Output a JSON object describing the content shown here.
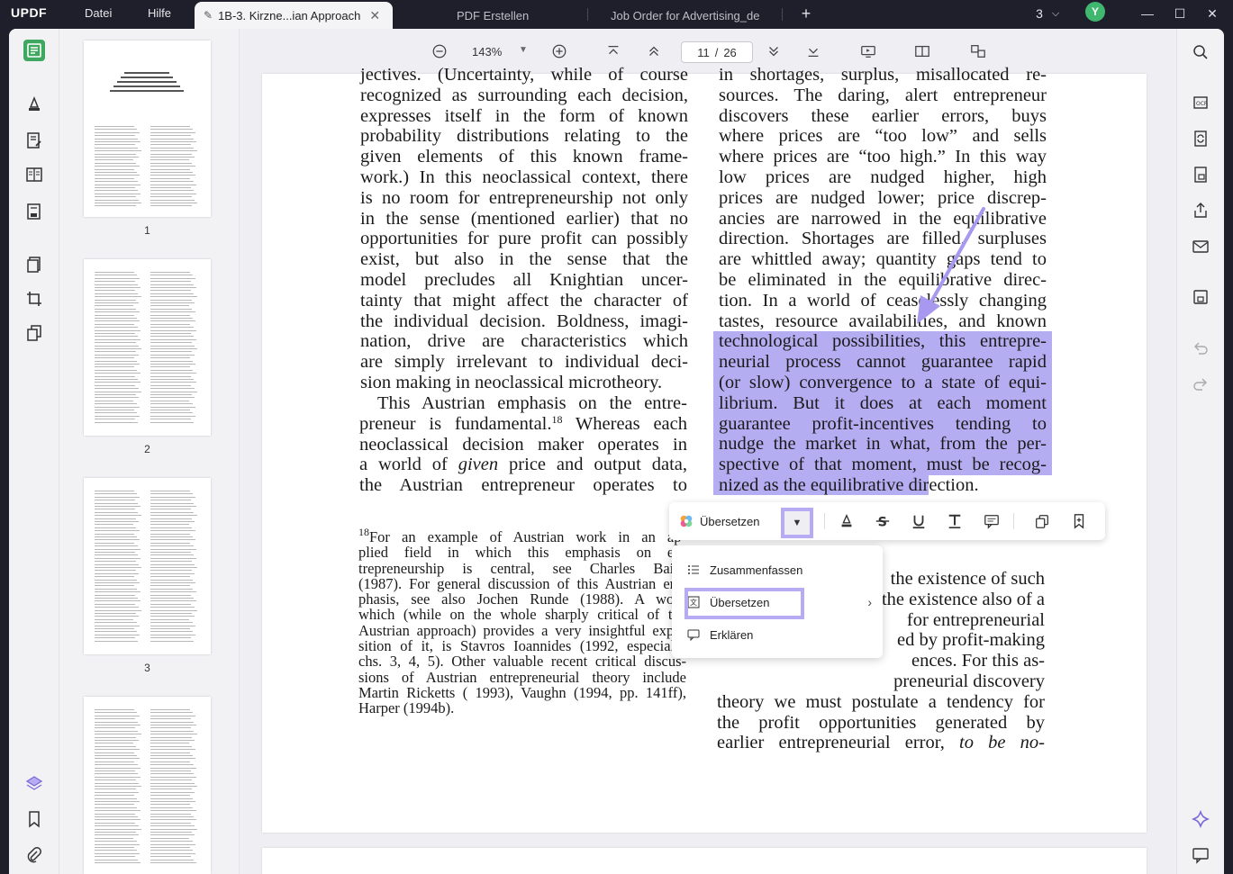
{
  "app": {
    "name_prefix": "UPDF",
    "menu": [
      "Datei",
      "Hilfe"
    ]
  },
  "tabs": [
    {
      "label": "1B-3. Kirzne...ian Approach",
      "active": true
    },
    {
      "label": "PDF Erstellen",
      "active": false
    },
    {
      "label": "Job Order for Advertising_de",
      "active": false
    }
  ],
  "window": {
    "tab_count": "3",
    "avatar_initial": "Y"
  },
  "toolbar": {
    "zoom": "143%",
    "page_current": "11",
    "page_total": "26",
    "page_sep": "/"
  },
  "thumbnails": [
    {
      "num": "1"
    },
    {
      "num": "2"
    },
    {
      "num": "3"
    }
  ],
  "left_column": [
    {
      "t": "jectives. (Uncertainty, while of course"
    },
    {
      "t": "recognized as surrounding each decision,"
    },
    {
      "t": "expresses itself in the form of known"
    },
    {
      "t": "probability distributions relating to the"
    },
    {
      "t": "given elements of this known frame-"
    },
    {
      "t": "work.) In this neoclassical context, there"
    },
    {
      "t": "is no room for entrepreneurship not only"
    },
    {
      "t": "in the sense (mentioned earlier) that no"
    },
    {
      "t": "opportunities for pure profit can possibly"
    },
    {
      "t": "exist, but also in the sense that the"
    },
    {
      "t": "model precludes all Knightian uncer-"
    },
    {
      "t": "tainty that might affect the character of"
    },
    {
      "t": "the individual decision. Boldness, imagi-"
    },
    {
      "t": "nation, drive are characteristics which"
    },
    {
      "t": "are simply irrelevant to individual deci-"
    },
    {
      "t": "sion making in neoclassical microtheory."
    }
  ],
  "left_para2": {
    "l1": "This Austrian emphasis on the entre-",
    "l2a": "preneur is fundamental.",
    "l2sup": "18",
    "l2b": " Whereas each",
    "l3": "neoclassical decision maker operates in",
    "l4a": "a world of ",
    "l4em": "given",
    "l4b": " price and output data,",
    "l5": "the Austrian entrepreneur operates to"
  },
  "footnote": {
    "sup": "18",
    "l1": "For an example of Austrian work in an ap-",
    "lines": [
      "plied field in which this emphasis on en-",
      "trepreneurship is central, see Charles Baird",
      "(1987). For general discussion of this Austrian em-",
      "phasis, see also Jochen Runde (1988). A work",
      "which (while on the whole sharply critical of the",
      "Austrian approach) provides a very insightful expo-",
      "sition of it, is Stavros Ioannides (1992, especially",
      "chs. 3, 4, 5). Other valuable recent critical discus-",
      "sions of Austrian entrepreneurial theory include",
      "Martin Ricketts ( 1993), Vaughn (1994, pp. 141ff),",
      "Harper (1994b)."
    ]
  },
  "right_column": [
    "in shortages, surplus, misallocated re-",
    "sources. The daring, alert entrepreneur",
    "discovers these earlier errors, buys",
    "where prices are “too low” and sells",
    "where prices are “too high.” In this way",
    "low prices are nudged higher, high",
    "prices are nudged lower; price discrep-",
    "ancies are narrowed in the equilibrative",
    "direction. Shortages are filled, surpluses",
    "are whittled away; quantity gaps tend to",
    "be eliminated in the equilibrative direc-",
    "tion. In a world of ceaselessly changing",
    "tastes, resource availabilities, and known"
  ],
  "right_highlighted": [
    "technological possibilities, this entrepre-",
    "neurial process cannot guarantee rapid",
    "(or slow) convergence to a state of equi-",
    "librium. But it does at each moment",
    "guarantee profit-incentives tending to",
    "nudge the market in what, from the per-",
    "spective of that moment, must be recog-"
  ],
  "right_last_hl": {
    "hl": "nized as the equilibrative dir",
    "rest": "ection."
  },
  "right_lower": [
    "the existence of such",
    "the existence also of a",
    "for entrepreneurial",
    "ed by profit-making",
    "ences. For this as-",
    "preneurial discovery",
    "theory we must postulate a tendency for",
    "the profit opportunities generated by"
  ],
  "right_final": {
    "a": "earlier entrepreneurial error, ",
    "em": "to be no-"
  },
  "float_bar": {
    "translate_label": "Übersetzen"
  },
  "dropdown": {
    "items": [
      {
        "label": "Zusammenfassen"
      },
      {
        "label": "Übersetzen"
      },
      {
        "label": "Erklären"
      }
    ]
  },
  "colors": {
    "highlight": "#b5adf2",
    "annotation": "#b7acf3",
    "accent_green": "#3fa860"
  }
}
